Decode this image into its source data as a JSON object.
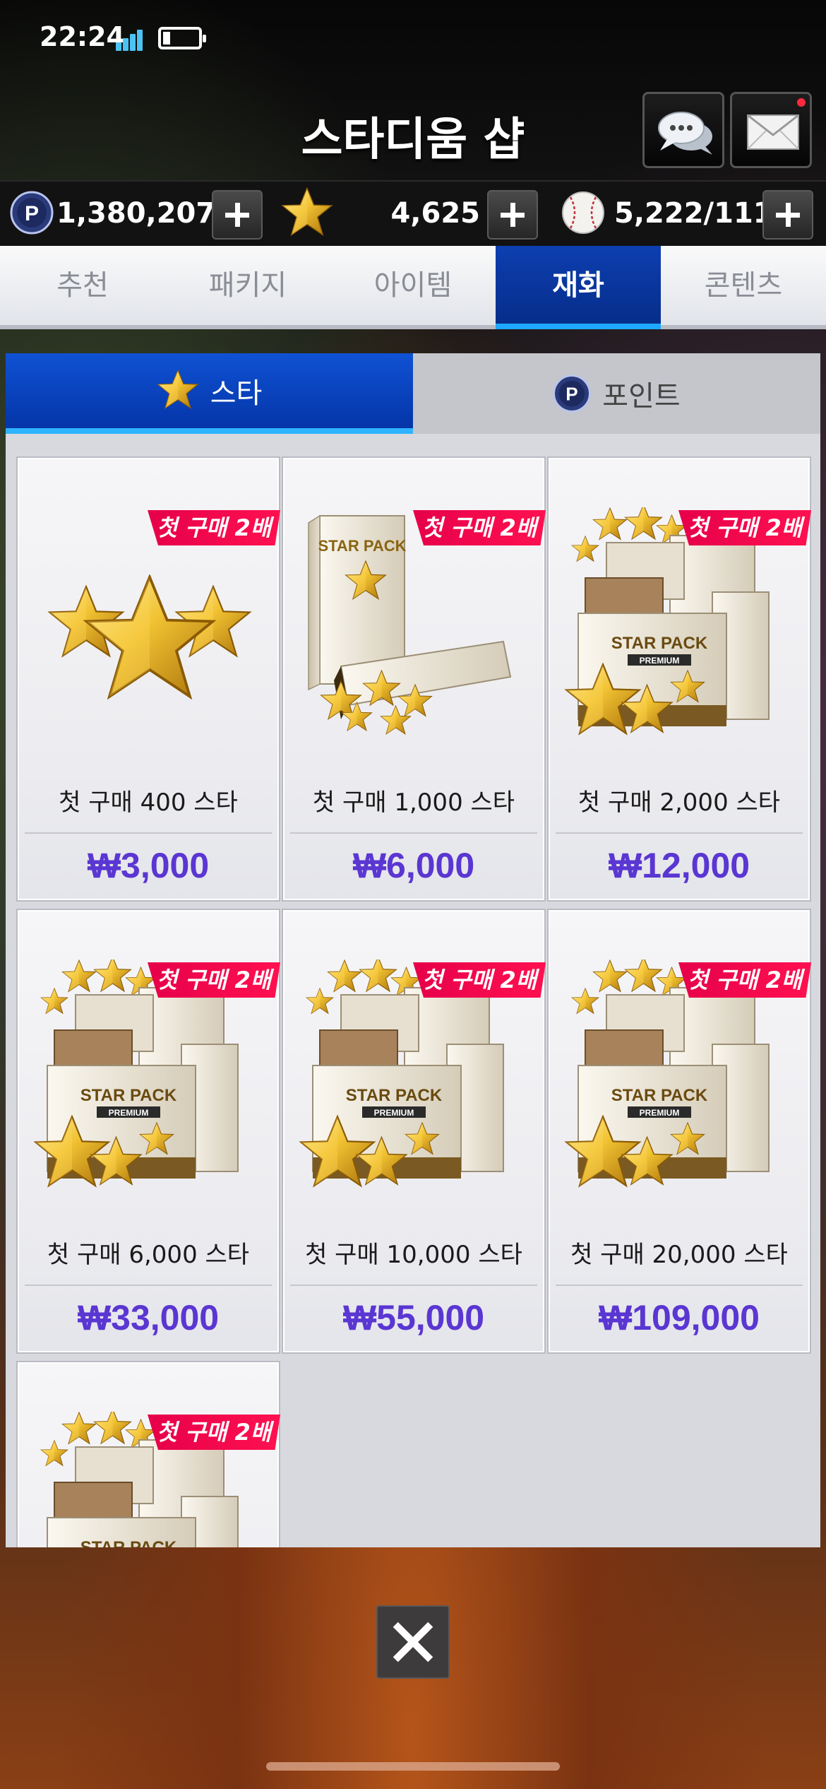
{
  "status": {
    "time": "22:24"
  },
  "header": {
    "title": "스타디움 샵"
  },
  "currency": {
    "points": "1,380,207",
    "stars": "4,625",
    "balls": "5,222/111"
  },
  "category_tabs": [
    {
      "label": "추천"
    },
    {
      "label": "패키지"
    },
    {
      "label": "아이템"
    },
    {
      "label": "재화",
      "active": true
    },
    {
      "label": "콘텐츠"
    }
  ],
  "sub_tabs": [
    {
      "label": "스타",
      "active": true
    },
    {
      "label": "포인트"
    }
  ],
  "products": [
    {
      "badge": "첫 구매 2배",
      "name": "첫 구매 400 스타",
      "price": "₩3,000",
      "art": "stars-cluster-icon"
    },
    {
      "badge": "첫 구매 2배",
      "name": "첫 구매 1,000 스타",
      "price": "₩6,000",
      "art": "star-pack-box-icon"
    },
    {
      "badge": "첫 구매 2배",
      "name": "첫 구매 2,000 스타",
      "price": "₩12,000",
      "art": "star-pack-premium-icon"
    },
    {
      "badge": "첫 구매 2배",
      "name": "첫 구매 6,000 스타",
      "price": "₩33,000",
      "art": "star-pack-premium-icon"
    },
    {
      "badge": "첫 구매 2배",
      "name": "첫 구매 10,000 스타",
      "price": "₩55,000",
      "art": "star-pack-premium-icon"
    },
    {
      "badge": "첫 구매 2배",
      "name": "첫 구매 20,000 스타",
      "price": "₩109,000",
      "art": "star-pack-premium-icon"
    },
    {
      "badge": "첫 구매 2배",
      "name": "",
      "price": "",
      "art": "star-pack-premium-icon"
    }
  ],
  "pack_art": {
    "brand": "STAR PACK",
    "tier": "PREMIUM"
  },
  "colors": {
    "active_tab": "#0d3fb0",
    "active_underline": "#1fa8ff",
    "ribbon": "#ff1150",
    "price": "#5a36d2",
    "gold": "#e8b31e"
  }
}
